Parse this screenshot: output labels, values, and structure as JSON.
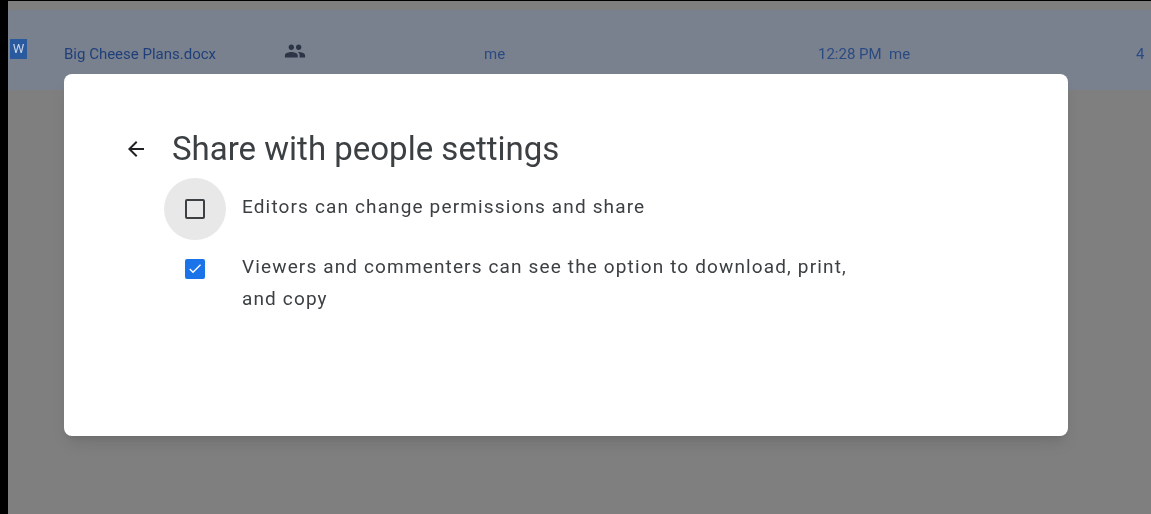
{
  "file_row": {
    "type_badge": "W",
    "name": "Big Cheese Plans.docx",
    "shared": true,
    "owner": "me",
    "modified": "12:28 PM",
    "modified_by": "me",
    "column_5": "4"
  },
  "dialog": {
    "title": "Share with people settings",
    "options": [
      {
        "label": "Editors can change permissions and share",
        "checked": false,
        "focused": true
      },
      {
        "label": "Viewers and commenters can see the option to download, print, and copy",
        "checked": true,
        "focused": false
      }
    ]
  }
}
